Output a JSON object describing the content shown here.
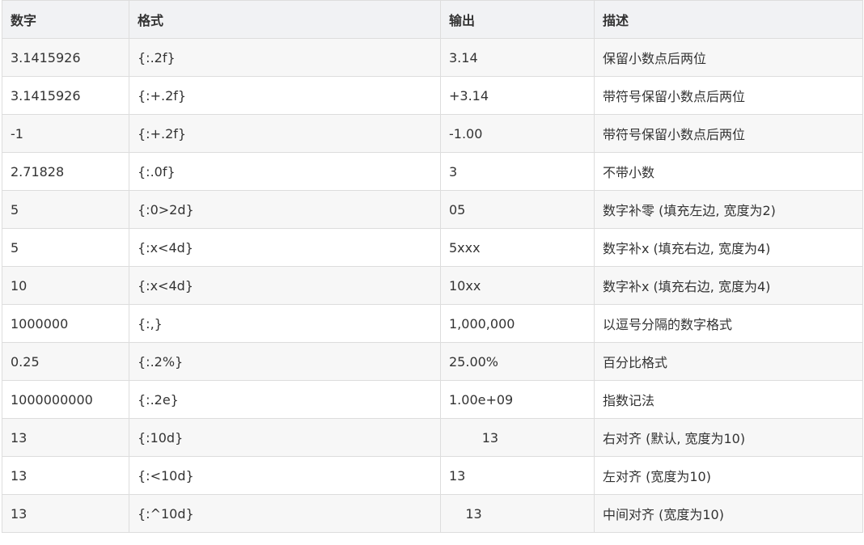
{
  "table": {
    "headers": [
      "数字",
      "格式",
      "输出",
      "描述"
    ],
    "rows": [
      [
        "3.1415926",
        "{:.2f}",
        "3.14",
        "保留小数点后两位"
      ],
      [
        "3.1415926",
        "{:+.2f}",
        "+3.14",
        "带符号保留小数点后两位"
      ],
      [
        "-1",
        "{:+.2f}",
        "-1.00",
        "带符号保留小数点后两位"
      ],
      [
        "2.71828",
        "{:.0f}",
        "3",
        "不带小数"
      ],
      [
        "5",
        "{:0>2d}",
        "05",
        "数字补零 (填充左边, 宽度为2)"
      ],
      [
        "5",
        "{:x<4d}",
        "5xxx",
        "数字补x (填充右边, 宽度为4)"
      ],
      [
        "10",
        "{:x<4d}",
        "10xx",
        "数字补x (填充右边, 宽度为4)"
      ],
      [
        "1000000",
        "{:,}",
        "1,000,000",
        "以逗号分隔的数字格式"
      ],
      [
        "0.25",
        "{:.2%}",
        "25.00%",
        "百分比格式"
      ],
      [
        "1000000000",
        "{:.2e}",
        "1.00e+09",
        "指数记法"
      ],
      [
        "13",
        "{:10d}",
        "        13",
        "右对齐 (默认, 宽度为10)"
      ],
      [
        "13",
        "{:<10d}",
        "13",
        "左对齐 (宽度为10)"
      ],
      [
        "13",
        "{:^10d}",
        "    13",
        "中间对齐 (宽度为10)"
      ]
    ]
  }
}
